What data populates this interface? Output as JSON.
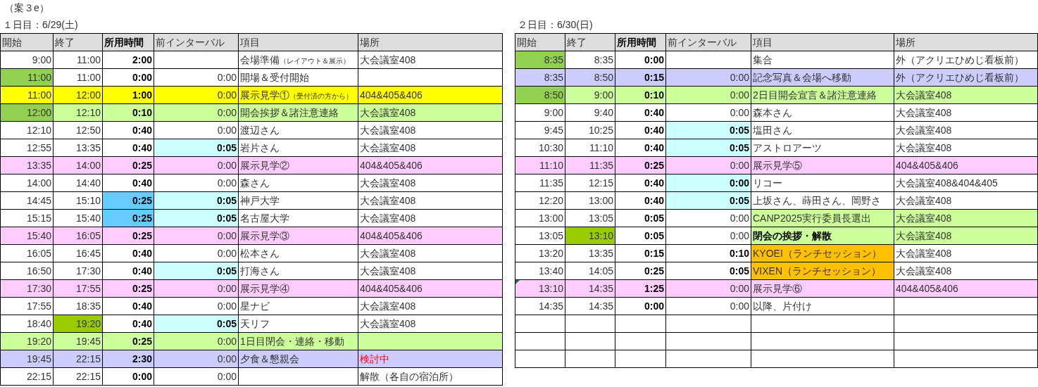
{
  "plan_label": "（案３e）",
  "days": [
    {
      "title": "１日目：6/29(土)",
      "columns": [
        {
          "label": "開始",
          "bold": false
        },
        {
          "label": "終了",
          "bold": false
        },
        {
          "label": "所用時間",
          "bold": true
        },
        {
          "label": "前インターバル",
          "bold": false
        },
        {
          "label": "項目",
          "bold": false
        },
        {
          "label": "場所",
          "bold": false
        }
      ],
      "rows": [
        {
          "cells": [
            {
              "text": "9:00",
              "color": "#ffffff"
            },
            {
              "text": "11:00",
              "color": "#ffffff"
            },
            {
              "text": "2:00",
              "color": "#ffffff"
            },
            {
              "color": "#ffffff"
            },
            {
              "text": "会場準備",
              "color": "#ffffff"
            },
            {
              "text": "大会議室408",
              "color": "#ffffff"
            }
          ],
          "note": "（レイアウト＆展示）",
          "item_bold": false,
          "place_alert": false,
          "comment_mark": false
        },
        {
          "cells": [
            {
              "text": "11:00",
              "color": "#92d050"
            },
            {
              "text": "11:00",
              "color": "#ffffff"
            },
            {
              "text": "0:00",
              "color": "#ffffff"
            },
            {
              "text": "0:00",
              "color": "#ffffff"
            },
            {
              "text": "開場＆受付開始",
              "color": "#ffffff"
            },
            {
              "color": "#ffffff"
            }
          ],
          "interval_bold": false,
          "item_bold": false,
          "comment_mark": false
        },
        {
          "cells": [
            {
              "text": "11:00",
              "color": "#ffff00"
            },
            {
              "text": "12:00",
              "color": "#ffff00"
            },
            {
              "text": "1:00",
              "color": "#ffff00"
            },
            {
              "text": "0:00",
              "color": "#ffff00"
            },
            {
              "text": "展示見学①",
              "color": "#ffff00"
            },
            {
              "text": "404&405&406",
              "color": "#ffff00"
            }
          ],
          "note": "（受付済の方から）",
          "interval_bold": false,
          "item_bold": false,
          "place_alert": false,
          "comment_mark": false
        },
        {
          "cells": [
            {
              "text": "12:00",
              "color": "#92d050"
            },
            {
              "text": "12:10",
              "color": "#ccff99"
            },
            {
              "text": "0:10",
              "color": "#ccff99"
            },
            {
              "text": "0:00",
              "color": "#ccff99"
            },
            {
              "text": "開会挨拶＆諸注意連絡",
              "color": "#ccff99"
            },
            {
              "text": "大会議室408",
              "color": "#ccff99"
            }
          ],
          "interval_bold": false,
          "item_bold": false,
          "place_alert": false,
          "comment_mark": false
        },
        {
          "cells": [
            {
              "text": "12:10",
              "color": "#ffffff"
            },
            {
              "text": "12:50",
              "color": "#ffffff"
            },
            {
              "text": "0:40",
              "color": "#ffffff"
            },
            {
              "text": "0:00",
              "color": "#ffffff"
            },
            {
              "text": "渡辺さん",
              "color": "#ffffff"
            },
            {
              "text": "大会議室408",
              "color": "#ffffff"
            }
          ],
          "interval_bold": false,
          "item_bold": false,
          "place_alert": false,
          "comment_mark": false
        },
        {
          "cells": [
            {
              "text": "12:55",
              "color": "#ffffff"
            },
            {
              "text": "13:35",
              "color": "#ffffff"
            },
            {
              "text": "0:40",
              "color": "#ffffff"
            },
            {
              "text": "0:05",
              "color": "#ccffff"
            },
            {
              "text": "岩片さん",
              "color": "#ffffff"
            },
            {
              "text": "大会議室408",
              "color": "#ffffff"
            }
          ],
          "interval_bold": true,
          "item_bold": false,
          "place_alert": false,
          "comment_mark": false
        },
        {
          "cells": [
            {
              "text": "13:35",
              "color": "#ffccff"
            },
            {
              "text": "14:00",
              "color": "#ffccff"
            },
            {
              "text": "0:25",
              "color": "#ffccff"
            },
            {
              "text": "0:00",
              "color": "#ffccff"
            },
            {
              "text": "展示見学②",
              "color": "#ffccff"
            },
            {
              "text": "404&405&406",
              "color": "#ffccff"
            }
          ],
          "interval_bold": false,
          "item_bold": false,
          "place_alert": false,
          "comment_mark": false
        },
        {
          "cells": [
            {
              "text": "14:00",
              "color": "#ffffff"
            },
            {
              "text": "14:40",
              "color": "#ffffff"
            },
            {
              "text": "0:40",
              "color": "#ffffff"
            },
            {
              "text": "0:00",
              "color": "#ffffff"
            },
            {
              "text": "森さん",
              "color": "#ffffff"
            },
            {
              "text": "大会議室408",
              "color": "#ffffff"
            }
          ],
          "interval_bold": false,
          "item_bold": false,
          "place_alert": false,
          "comment_mark": false
        },
        {
          "cells": [
            {
              "text": "14:45",
              "color": "#ffffff"
            },
            {
              "text": "15:10",
              "color": "#ffffff"
            },
            {
              "text": "0:25",
              "color": "#66ccff"
            },
            {
              "text": "0:05",
              "color": "#ccffff"
            },
            {
              "text": "神戸大学",
              "color": "#ffffff"
            },
            {
              "text": "大会議室408",
              "color": "#ffffff"
            }
          ],
          "interval_bold": true,
          "item_bold": false,
          "place_alert": false,
          "comment_mark": false
        },
        {
          "cells": [
            {
              "text": "15:15",
              "color": "#ffffff"
            },
            {
              "text": "15:40",
              "color": "#ffffff"
            },
            {
              "text": "0:25",
              "color": "#66ccff"
            },
            {
              "text": "0:05",
              "color": "#ccffff"
            },
            {
              "text": "名古屋大学",
              "color": "#ffffff"
            },
            {
              "text": "大会議室408",
              "color": "#ffffff"
            }
          ],
          "interval_bold": true,
          "item_bold": false,
          "place_alert": false,
          "comment_mark": false
        },
        {
          "cells": [
            {
              "text": "15:40",
              "color": "#ffccff"
            },
            {
              "text": "16:05",
              "color": "#ffccff"
            },
            {
              "text": "0:25",
              "color": "#ffccff"
            },
            {
              "text": "0:00",
              "color": "#ffccff"
            },
            {
              "text": "展示見学③",
              "color": "#ffccff"
            },
            {
              "text": "404&405&406",
              "color": "#ffccff"
            }
          ],
          "interval_bold": false,
          "item_bold": false,
          "place_alert": false,
          "comment_mark": false
        },
        {
          "cells": [
            {
              "text": "16:05",
              "color": "#ffffff"
            },
            {
              "text": "16:45",
              "color": "#ffffff"
            },
            {
              "text": "0:40",
              "color": "#ffffff"
            },
            {
              "text": "0:00",
              "color": "#ffffff"
            },
            {
              "text": "松本さん",
              "color": "#ffffff"
            },
            {
              "text": "大会議室408",
              "color": "#ffffff"
            }
          ],
          "interval_bold": false,
          "item_bold": false,
          "place_alert": false,
          "comment_mark": false
        },
        {
          "cells": [
            {
              "text": "16:50",
              "color": "#ffffff"
            },
            {
              "text": "17:30",
              "color": "#ffffff"
            },
            {
              "text": "0:40",
              "color": "#ffffff"
            },
            {
              "text": "0:05",
              "color": "#ccffff"
            },
            {
              "text": "打海さん",
              "color": "#ffffff"
            },
            {
              "text": "大会議室408",
              "color": "#ffffff"
            }
          ],
          "interval_bold": true,
          "item_bold": false,
          "place_alert": false,
          "comment_mark": false
        },
        {
          "cells": [
            {
              "text": "17:30",
              "color": "#ffccff"
            },
            {
              "text": "17:55",
              "color": "#ffccff"
            },
            {
              "text": "0:25",
              "color": "#ffccff"
            },
            {
              "text": "0:00",
              "color": "#ffccff"
            },
            {
              "text": "展示見学④",
              "color": "#ffccff"
            },
            {
              "text": "404&405&406",
              "color": "#ffccff"
            }
          ],
          "interval_bold": false,
          "item_bold": false,
          "place_alert": false,
          "comment_mark": false
        },
        {
          "cells": [
            {
              "text": "17:55",
              "color": "#ffffff"
            },
            {
              "text": "18:35",
              "color": "#ffffff"
            },
            {
              "text": "0:40",
              "color": "#ffffff"
            },
            {
              "text": "0:00",
              "color": "#ffffff"
            },
            {
              "text": "星ナビ",
              "color": "#ffffff"
            },
            {
              "text": "大会議室408",
              "color": "#ffffff"
            }
          ],
          "interval_bold": false,
          "item_bold": false,
          "place_alert": false,
          "comment_mark": false
        },
        {
          "cells": [
            {
              "text": "18:40",
              "color": "#ffffff"
            },
            {
              "text": "19:20",
              "color": "#99cc00"
            },
            {
              "text": "0:40",
              "color": "#ffffff"
            },
            {
              "text": "0:05",
              "color": "#ccffff"
            },
            {
              "text": "天リフ",
              "color": "#ffffff"
            },
            {
              "text": "大会議室408",
              "color": "#ffffff"
            }
          ],
          "interval_bold": true,
          "item_bold": false,
          "place_alert": false,
          "comment_mark": false
        },
        {
          "cells": [
            {
              "text": "19:20",
              "color": "#ccff99"
            },
            {
              "text": "19:45",
              "color": "#ccff99"
            },
            {
              "text": "0:25",
              "color": "#ccff99"
            },
            {
              "text": "0:00",
              "color": "#ccff99"
            },
            {
              "text": "1日目閉会・連絡・移動",
              "color": "#ccff99"
            },
            {
              "color": "#ccff99"
            }
          ],
          "interval_bold": false,
          "item_bold": false,
          "comment_mark": false
        },
        {
          "cells": [
            {
              "text": "19:45",
              "color": "#ccccff"
            },
            {
              "text": "22:15",
              "color": "#ccccff"
            },
            {
              "text": "2:30",
              "color": "#ccccff"
            },
            {
              "text": "0:00",
              "color": "#ccccff"
            },
            {
              "text": "夕食＆懇親会",
              "color": "#ccccff"
            },
            {
              "text": "検討中",
              "color": "#ccccff"
            }
          ],
          "interval_bold": false,
          "item_bold": false,
          "place_alert": true,
          "comment_mark": false
        },
        {
          "cells": [
            {
              "text": "22:15",
              "color": "#ffffff"
            },
            {
              "text": "22:15",
              "color": "#ffffff"
            },
            {
              "text": "0:00",
              "color": "#ffffff"
            },
            {
              "text": "0:00",
              "color": "#ffffff"
            },
            {
              "color": "#ffffff"
            },
            {
              "text": "解散（各自の宿泊所）",
              "color": "#ffffff"
            }
          ],
          "interval_bold": false,
          "place_alert": false,
          "comment_mark": false
        }
      ]
    },
    {
      "title": "２日目：6/30(日)",
      "columns": [
        {
          "label": "開始",
          "bold": false
        },
        {
          "label": "終了",
          "bold": false
        },
        {
          "label": "所用時間",
          "bold": true
        },
        {
          "label": "前インターバル",
          "bold": false
        },
        {
          "label": "項目",
          "bold": false
        },
        {
          "label": "場所",
          "bold": false
        }
      ],
      "rows": [
        {
          "cells": [
            {
              "text": "8:35",
              "color": "#92d050"
            },
            {
              "text": "8:35",
              "color": "#ffffff"
            },
            {
              "text": "0:00",
              "color": "#ffffff"
            },
            {
              "color": "#ffffff"
            },
            {
              "text": "集合",
              "color": "#ffffff"
            },
            {
              "text": "外（アクリエひめじ看板前）",
              "color": "#ffffff"
            }
          ],
          "item_bold": false,
          "place_alert": false,
          "comment_mark": false
        },
        {
          "cells": [
            {
              "text": "8:35",
              "color": "#ccccff"
            },
            {
              "text": "8:50",
              "color": "#ccccff"
            },
            {
              "text": "0:15",
              "color": "#ccccff"
            },
            {
              "text": "0:00",
              "color": "#ccccff"
            },
            {
              "text": "記念写真＆会場へ移動",
              "color": "#ccccff"
            },
            {
              "text": "外（アクリエひめじ看板前）",
              "color": "#ccccff"
            }
          ],
          "interval_bold": false,
          "item_bold": false,
          "place_alert": false,
          "comment_mark": false
        },
        {
          "cells": [
            {
              "text": "8:50",
              "color": "#92d050"
            },
            {
              "text": "9:00",
              "color": "#ccff99"
            },
            {
              "text": "0:10",
              "color": "#ccff99"
            },
            {
              "text": "0:00",
              "color": "#ccff99"
            },
            {
              "text": "2日目開会宣言＆諸注意連絡",
              "color": "#ccff99"
            },
            {
              "text": "大会議室408",
              "color": "#ccff99"
            }
          ],
          "interval_bold": false,
          "item_bold": false,
          "place_alert": false,
          "comment_mark": false
        },
        {
          "cells": [
            {
              "text": "9:00",
              "color": "#ffffff"
            },
            {
              "text": "9:40",
              "color": "#ffffff"
            },
            {
              "text": "0:40",
              "color": "#ffffff"
            },
            {
              "text": "0:00",
              "color": "#ffffff"
            },
            {
              "text": "森本さん",
              "color": "#ffffff"
            },
            {
              "text": "大会議室408",
              "color": "#ffffff"
            }
          ],
          "interval_bold": false,
          "item_bold": false,
          "place_alert": false,
          "comment_mark": false
        },
        {
          "cells": [
            {
              "text": "9:45",
              "color": "#ffffff"
            },
            {
              "text": "10:25",
              "color": "#ffffff"
            },
            {
              "text": "0:40",
              "color": "#ffffff"
            },
            {
              "text": "0:05",
              "color": "#ccffff"
            },
            {
              "text": "塩田さん",
              "color": "#ffffff"
            },
            {
              "text": "大会議室408",
              "color": "#ffffff"
            }
          ],
          "interval_bold": true,
          "item_bold": false,
          "place_alert": false,
          "comment_mark": false
        },
        {
          "cells": [
            {
              "text": "10:30",
              "color": "#ffffff"
            },
            {
              "text": "11:10",
              "color": "#ffffff"
            },
            {
              "text": "0:40",
              "color": "#ffffff"
            },
            {
              "text": "0:05",
              "color": "#ccffff"
            },
            {
              "text": "アストロアーツ",
              "color": "#ffffff"
            },
            {
              "text": "大会議室408",
              "color": "#ffffff"
            }
          ],
          "interval_bold": true,
          "item_bold": false,
          "place_alert": false,
          "comment_mark": false
        },
        {
          "cells": [
            {
              "text": "11:10",
              "color": "#ffccff"
            },
            {
              "text": "11:35",
              "color": "#ffccff"
            },
            {
              "text": "0:25",
              "color": "#ffccff"
            },
            {
              "text": "0:00",
              "color": "#ffccff"
            },
            {
              "text": "展示見学⑤",
              "color": "#ffccff"
            },
            {
              "text": "404&405&406",
              "color": "#ffccff"
            }
          ],
          "interval_bold": false,
          "item_bold": false,
          "place_alert": false,
          "comment_mark": false
        },
        {
          "cells": [
            {
              "text": "11:35",
              "color": "#ffffff"
            },
            {
              "text": "12:15",
              "color": "#ffffff"
            },
            {
              "text": "0:40",
              "color": "#ffffff"
            },
            {
              "text": "0:00",
              "color": "#ccffff"
            },
            {
              "text": "リコー",
              "color": "#ffffff"
            },
            {
              "text": "大会議室408&404&405",
              "color": "#ffffff"
            }
          ],
          "interval_bold": true,
          "item_bold": false,
          "place_alert": false,
          "comment_mark": false
        },
        {
          "cells": [
            {
              "text": "12:20",
              "color": "#ffffff"
            },
            {
              "text": "13:00",
              "color": "#ffffff"
            },
            {
              "text": "0:40",
              "color": "#ffffff"
            },
            {
              "text": "0:05",
              "color": "#ccffff"
            },
            {
              "text": "上坂さん、蒔田さん、岡野さ",
              "color": "#ffffff"
            },
            {
              "text": "大会議室408",
              "color": "#ffffff"
            }
          ],
          "interval_bold": true,
          "item_bold": false,
          "place_alert": false,
          "comment_mark": false
        },
        {
          "cells": [
            {
              "text": "13:00",
              "color": "#ffffff"
            },
            {
              "text": "13:05",
              "color": "#ffffff"
            },
            {
              "text": "0:05",
              "color": "#ffffff"
            },
            {
              "text": "0:00",
              "color": "#ffffff"
            },
            {
              "text": "CANP2025実行委員長選出",
              "color": "#ccff99"
            },
            {
              "text": "大会議室408",
              "color": "#ccff99"
            }
          ],
          "interval_bold": false,
          "item_bold": false,
          "place_alert": false,
          "comment_mark": false
        },
        {
          "cells": [
            {
              "text": "13:05",
              "color": "#ffffff"
            },
            {
              "text": "13:10",
              "color": "#99cc00"
            },
            {
              "text": "0:05",
              "color": "#ffffff"
            },
            {
              "text": "0:00",
              "color": "#ffffff"
            },
            {
              "text": "閉会の挨拶・解散",
              "color": "#ccff99"
            },
            {
              "text": "大会議室408",
              "color": "#ccff99"
            }
          ],
          "interval_bold": false,
          "item_bold": true,
          "place_alert": false,
          "comment_mark": false
        },
        {
          "cells": [
            {
              "text": "13:20",
              "color": "#ffffff"
            },
            {
              "text": "13:35",
              "color": "#ffffff"
            },
            {
              "text": "0:15",
              "color": "#ffffff"
            },
            {
              "text": "0:10",
              "color": "#ffffff"
            },
            {
              "text": "KYOEI（ランチセッション）",
              "color": "#ffc000"
            },
            {
              "text": "大会議室408",
              "color": "#ffffff"
            }
          ],
          "interval_bold": true,
          "item_bold": false,
          "place_alert": false,
          "comment_mark": false
        },
        {
          "cells": [
            {
              "text": "13:40",
              "color": "#ffffff"
            },
            {
              "text": "14:05",
              "color": "#ffffff"
            },
            {
              "text": "0:25",
              "color": "#ffffff"
            },
            {
              "text": "0:05",
              "color": "#ffffff"
            },
            {
              "text": "VIXEN（ランチセッション）",
              "color": "#ffc000"
            },
            {
              "text": "大会議室408",
              "color": "#ffffff"
            }
          ],
          "interval_bold": true,
          "item_bold": false,
          "place_alert": false,
          "comment_mark": false
        },
        {
          "cells": [
            {
              "text": "13:10",
              "color": "#ffccff"
            },
            {
              "text": "14:35",
              "color": "#ffccff"
            },
            {
              "text": "1:25",
              "color": "#ffccff"
            },
            {
              "text": "0:00",
              "color": "#ffccff"
            },
            {
              "text": "展示見学⑥",
              "color": "#ffccff"
            },
            {
              "text": "404&405&406",
              "color": "#ffccff"
            }
          ],
          "interval_bold": false,
          "item_bold": false,
          "place_alert": false,
          "comment_mark": true
        },
        {
          "cells": [
            {
              "text": "14:35",
              "color": "#ffffff"
            },
            {
              "text": "14:35",
              "color": "#ffffff"
            },
            {
              "text": "0:00",
              "color": "#ffffff"
            },
            {
              "text": "0:00",
              "color": "#ffffff"
            },
            {
              "text": "以降、片付け",
              "color": "#ffffff"
            },
            {
              "color": "#ffffff"
            }
          ],
          "interval_bold": false,
          "item_bold": false,
          "comment_mark": false
        },
        {
          "kind": "blank"
        },
        {
          "kind": "blank"
        },
        {
          "kind": "blank"
        }
      ]
    }
  ]
}
